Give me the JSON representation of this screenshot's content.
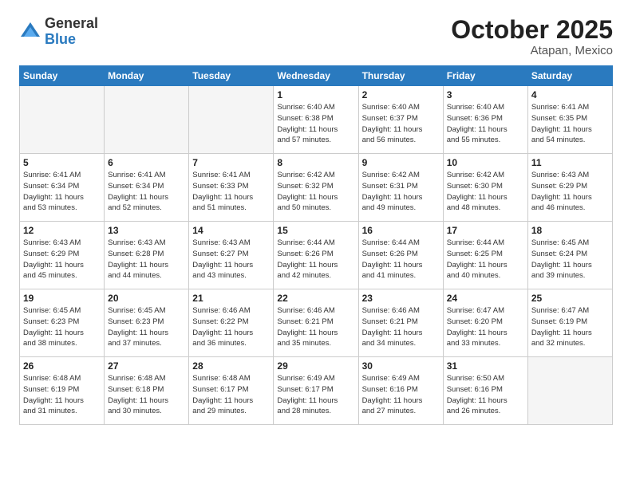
{
  "logo": {
    "general": "General",
    "blue": "Blue"
  },
  "title": "October 2025",
  "location": "Atapan, Mexico",
  "days_of_week": [
    "Sunday",
    "Monday",
    "Tuesday",
    "Wednesday",
    "Thursday",
    "Friday",
    "Saturday"
  ],
  "weeks": [
    [
      {
        "day": "",
        "info": ""
      },
      {
        "day": "",
        "info": ""
      },
      {
        "day": "",
        "info": ""
      },
      {
        "day": "1",
        "info": "Sunrise: 6:40 AM\nSunset: 6:38 PM\nDaylight: 11 hours\nand 57 minutes."
      },
      {
        "day": "2",
        "info": "Sunrise: 6:40 AM\nSunset: 6:37 PM\nDaylight: 11 hours\nand 56 minutes."
      },
      {
        "day": "3",
        "info": "Sunrise: 6:40 AM\nSunset: 6:36 PM\nDaylight: 11 hours\nand 55 minutes."
      },
      {
        "day": "4",
        "info": "Sunrise: 6:41 AM\nSunset: 6:35 PM\nDaylight: 11 hours\nand 54 minutes."
      }
    ],
    [
      {
        "day": "5",
        "info": "Sunrise: 6:41 AM\nSunset: 6:34 PM\nDaylight: 11 hours\nand 53 minutes."
      },
      {
        "day": "6",
        "info": "Sunrise: 6:41 AM\nSunset: 6:34 PM\nDaylight: 11 hours\nand 52 minutes."
      },
      {
        "day": "7",
        "info": "Sunrise: 6:41 AM\nSunset: 6:33 PM\nDaylight: 11 hours\nand 51 minutes."
      },
      {
        "day": "8",
        "info": "Sunrise: 6:42 AM\nSunset: 6:32 PM\nDaylight: 11 hours\nand 50 minutes."
      },
      {
        "day": "9",
        "info": "Sunrise: 6:42 AM\nSunset: 6:31 PM\nDaylight: 11 hours\nand 49 minutes."
      },
      {
        "day": "10",
        "info": "Sunrise: 6:42 AM\nSunset: 6:30 PM\nDaylight: 11 hours\nand 48 minutes."
      },
      {
        "day": "11",
        "info": "Sunrise: 6:43 AM\nSunset: 6:29 PM\nDaylight: 11 hours\nand 46 minutes."
      }
    ],
    [
      {
        "day": "12",
        "info": "Sunrise: 6:43 AM\nSunset: 6:29 PM\nDaylight: 11 hours\nand 45 minutes."
      },
      {
        "day": "13",
        "info": "Sunrise: 6:43 AM\nSunset: 6:28 PM\nDaylight: 11 hours\nand 44 minutes."
      },
      {
        "day": "14",
        "info": "Sunrise: 6:43 AM\nSunset: 6:27 PM\nDaylight: 11 hours\nand 43 minutes."
      },
      {
        "day": "15",
        "info": "Sunrise: 6:44 AM\nSunset: 6:26 PM\nDaylight: 11 hours\nand 42 minutes."
      },
      {
        "day": "16",
        "info": "Sunrise: 6:44 AM\nSunset: 6:26 PM\nDaylight: 11 hours\nand 41 minutes."
      },
      {
        "day": "17",
        "info": "Sunrise: 6:44 AM\nSunset: 6:25 PM\nDaylight: 11 hours\nand 40 minutes."
      },
      {
        "day": "18",
        "info": "Sunrise: 6:45 AM\nSunset: 6:24 PM\nDaylight: 11 hours\nand 39 minutes."
      }
    ],
    [
      {
        "day": "19",
        "info": "Sunrise: 6:45 AM\nSunset: 6:23 PM\nDaylight: 11 hours\nand 38 minutes."
      },
      {
        "day": "20",
        "info": "Sunrise: 6:45 AM\nSunset: 6:23 PM\nDaylight: 11 hours\nand 37 minutes."
      },
      {
        "day": "21",
        "info": "Sunrise: 6:46 AM\nSunset: 6:22 PM\nDaylight: 11 hours\nand 36 minutes."
      },
      {
        "day": "22",
        "info": "Sunrise: 6:46 AM\nSunset: 6:21 PM\nDaylight: 11 hours\nand 35 minutes."
      },
      {
        "day": "23",
        "info": "Sunrise: 6:46 AM\nSunset: 6:21 PM\nDaylight: 11 hours\nand 34 minutes."
      },
      {
        "day": "24",
        "info": "Sunrise: 6:47 AM\nSunset: 6:20 PM\nDaylight: 11 hours\nand 33 minutes."
      },
      {
        "day": "25",
        "info": "Sunrise: 6:47 AM\nSunset: 6:19 PM\nDaylight: 11 hours\nand 32 minutes."
      }
    ],
    [
      {
        "day": "26",
        "info": "Sunrise: 6:48 AM\nSunset: 6:19 PM\nDaylight: 11 hours\nand 31 minutes."
      },
      {
        "day": "27",
        "info": "Sunrise: 6:48 AM\nSunset: 6:18 PM\nDaylight: 11 hours\nand 30 minutes."
      },
      {
        "day": "28",
        "info": "Sunrise: 6:48 AM\nSunset: 6:17 PM\nDaylight: 11 hours\nand 29 minutes."
      },
      {
        "day": "29",
        "info": "Sunrise: 6:49 AM\nSunset: 6:17 PM\nDaylight: 11 hours\nand 28 minutes."
      },
      {
        "day": "30",
        "info": "Sunrise: 6:49 AM\nSunset: 6:16 PM\nDaylight: 11 hours\nand 27 minutes."
      },
      {
        "day": "31",
        "info": "Sunrise: 6:50 AM\nSunset: 6:16 PM\nDaylight: 11 hours\nand 26 minutes."
      },
      {
        "day": "",
        "info": ""
      }
    ]
  ]
}
